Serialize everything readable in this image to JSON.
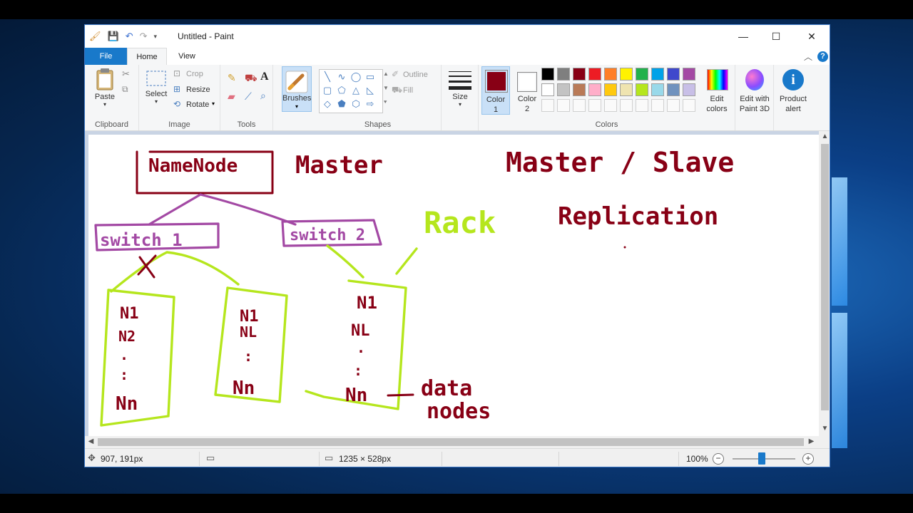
{
  "window": {
    "title": "Untitled - Paint",
    "controls": {
      "minimize": "—",
      "maximize": "☐",
      "close": "✕"
    }
  },
  "tabs": {
    "file": "File",
    "home": "Home",
    "view": "View"
  },
  "ribbon": {
    "clipboard": {
      "paste": "Paste",
      "group": "Clipboard"
    },
    "image": {
      "select": "Select",
      "crop": "Crop",
      "resize": "Resize",
      "rotate": "Rotate",
      "group": "Image"
    },
    "tools": {
      "group": "Tools"
    },
    "brushes": {
      "label": "Brushes"
    },
    "shapes": {
      "outline": "Outline",
      "fill": "Fill",
      "group": "Shapes"
    },
    "size": {
      "label": "Size"
    },
    "colors": {
      "color1": "Color",
      "color1_num": "1",
      "color2": "Color",
      "color2_num": "2",
      "edit_colors_1": "Edit",
      "edit_colors_2": "colors",
      "group": "Colors",
      "selected_color1": "#880015",
      "selected_color2": "#ffffff",
      "palette_row1": [
        "#000000",
        "#7f7f7f",
        "#880015",
        "#ed1c24",
        "#ff7f27",
        "#fff200",
        "#22b14c",
        "#00a2e8",
        "#3f48cc",
        "#a349a4"
      ],
      "palette_row2": [
        "#ffffff",
        "#c3c3c3",
        "#b97a57",
        "#ffaec9",
        "#ffc90e",
        "#efe4b0",
        "#b5e61d",
        "#99d9ea",
        "#7092be",
        "#c8bfe7"
      ]
    },
    "paint3d": {
      "line1": "Edit with",
      "line2": "Paint 3D"
    },
    "product_alert": {
      "line1": "Product",
      "line2": "alert"
    }
  },
  "canvas_text": {
    "namenode": "NameNode",
    "master": "Master",
    "master_slave": "Master / Slave",
    "replication": "Replication",
    "switch1": "switch 1",
    "switch2": "switch 2",
    "rack": "Rack",
    "x_mark": "X",
    "data_nodes_1": "data",
    "data_nodes_2": "nodes",
    "rack1": [
      "N1",
      "N2",
      ".",
      ":",
      "Nn"
    ],
    "rack2": [
      "N1",
      "NL",
      ":",
      "Nn"
    ],
    "rack3": [
      "N1",
      "NL",
      ".",
      ":",
      "Nn"
    ]
  },
  "status": {
    "cursor": "907, 191px",
    "size": "1235 × 528px",
    "zoom": "100%"
  }
}
